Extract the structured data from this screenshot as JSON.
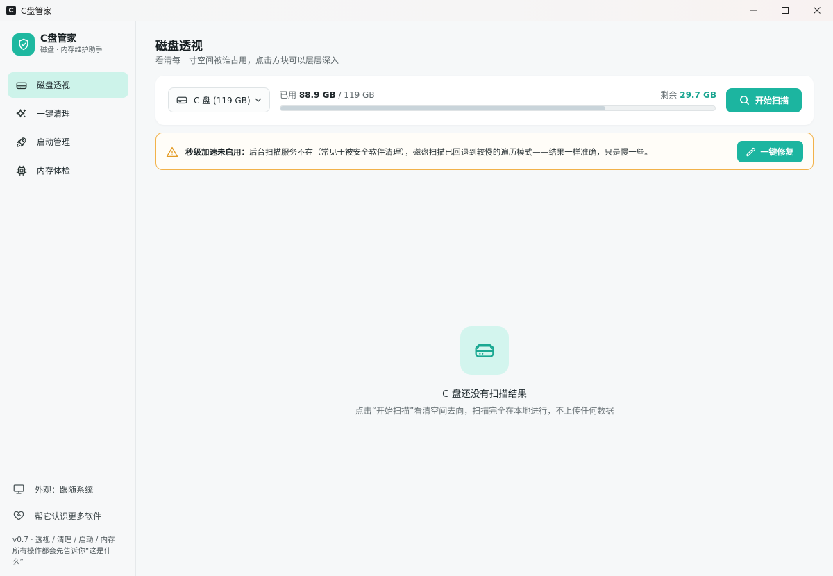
{
  "window": {
    "title": "C盘管家",
    "app_glyph": "C"
  },
  "brand": {
    "name": "C盘管家",
    "subtitle": "磁盘 · 内存维护助手"
  },
  "nav": {
    "items": [
      {
        "label": "磁盘透视",
        "icon": "disk-icon",
        "active": true
      },
      {
        "label": "一键清理",
        "icon": "sparkle-icon",
        "active": false
      },
      {
        "label": "启动管理",
        "icon": "rocket-icon",
        "active": false
      },
      {
        "label": "内存体检",
        "icon": "chip-icon",
        "active": false
      }
    ]
  },
  "sidebar_bottom": {
    "appearance": "外观：跟随系统",
    "support": "帮它认识更多软件",
    "version_line1": "v0.7 · 透视 / 清理 / 启动 / 内存",
    "version_line2": "所有操作都会先告诉你“这是什",
    "version_line3": "么”"
  },
  "page": {
    "title": "磁盘透视",
    "subtitle": "看清每一寸空间被谁占用，点击方块可以层层深入"
  },
  "disk": {
    "selected": "C 盘 (119 GB)",
    "used_prefix": "已用",
    "used_value": "88.9 GB",
    "total_text": "/ 119 GB",
    "free_prefix": "剩余",
    "free_value": "29.7 GB",
    "used_fraction": 0.747,
    "scan_label": "开始扫描"
  },
  "warning": {
    "bold": "秒级加速未启用：",
    "text": "后台扫描服务不在（常见于被安全软件清理），磁盘扫描已回退到较慢的遍历模式——结果一样准确，只是慢一些。",
    "fix_label": "一键修复"
  },
  "empty_state": {
    "title": "C 盘还没有扫描结果",
    "subtitle": "点击“开始扫描”看清空间去向，扫描完全在本地进行，不上传任何数据"
  },
  "colors": {
    "accent": "#1cb5a0",
    "active_nav": "#cdf3ea",
    "warning_border": "#f2b24a"
  }
}
